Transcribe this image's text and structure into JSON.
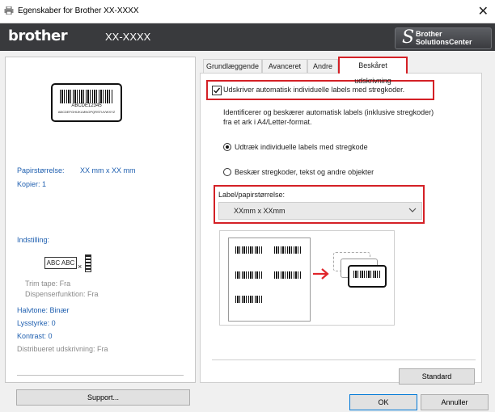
{
  "window": {
    "title": "Egenskaber for Brother  XX-XXXX",
    "close": "✕"
  },
  "brand": {
    "logo": "brother",
    "model": "XX-XXXX",
    "solutions_line1": "Brother",
    "solutions_line2": "SolutionsCenter"
  },
  "preview": {
    "barcode_text": "ABCDE12345",
    "barcode_subtext": "ABCDEFGHIJKLMNOPQRSTUVWXYZ"
  },
  "info": {
    "paper_label": "Papirstørrelse:",
    "paper_value": "XX mm x XX mm",
    "copies": "Kopier: 1",
    "settings_label": "Indstilling:",
    "tape_preview": "ABC ABC",
    "trim_tape": "Trim tape: Fra",
    "dispenser": "Dispenserfunktion: Fra",
    "halftone": "Halvtone: Binær",
    "brightness": "Lysstyrke:  0",
    "contrast": "Kontrast:  0",
    "distributed": "Distribueret udskrivning: Fra"
  },
  "buttons": {
    "support": "Support...",
    "standard": "Standard",
    "ok": "OK",
    "cancel": "Annuller"
  },
  "tabs": [
    "Grundlæggende",
    "Avanceret",
    "Andre",
    "Beskåret udskrivning"
  ],
  "crop": {
    "auto_checkbox_label": "Udskriver automatisk individuelle labels med stregkoder.",
    "auto_checked": true,
    "description_line1": "Identificerer og beskærer automatisk labels (inklusive stregkoder)",
    "description_line2": "fra et ark i A4/Letter-format.",
    "radio1": "Udtræk individuelle labels med stregkode",
    "radio2": "Beskær stregkoder, tekst og andre objekter",
    "selected_radio": 1,
    "size_label": "Label/papirstørrelse:",
    "size_value": "XXmm x XXmm"
  },
  "colors": {
    "highlight_red": "#d42026",
    "brand_bar": "#393a3d",
    "blue_text": "#2060b0",
    "arrow_red": "#e0262c"
  }
}
